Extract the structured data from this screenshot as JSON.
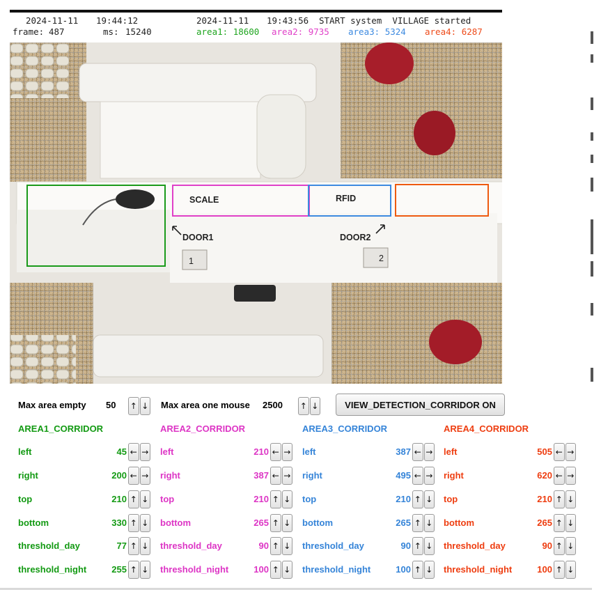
{
  "header": {
    "date": "2024-11-11",
    "time": "19:44:12",
    "frame_label": "frame:",
    "frame_value": "487",
    "ms_label": "ms:",
    "ms_value": "15240",
    "event_date": "2024-11-11",
    "event_time": "19:43:56",
    "event_text": "START system  VILLAGE started",
    "areas": [
      {
        "label": "area1:",
        "value": "18600",
        "color": "#1fa51f"
      },
      {
        "label": "area2:",
        "value": "9735",
        "color": "#e040c8"
      },
      {
        "label": "area3:",
        "value": "5324",
        "color": "#3d8ae0"
      },
      {
        "label": "area4:",
        "value": "6287",
        "color": "#ee4b1a"
      }
    ]
  },
  "camera": {
    "labels": {
      "scale": "SCALE",
      "rfid": "RFID",
      "door1": "DOOR1",
      "door2": "DOOR2",
      "marker1": "1",
      "marker2": "2"
    },
    "rect_colors": [
      "#1a9a1a",
      "#e040c8",
      "#3d8ae0",
      "#ee5a10"
    ]
  },
  "controls": {
    "max_area_empty_label": "Max area empty",
    "max_area_empty_value": "50",
    "max_area_one_mouse_label": "Max area one mouse",
    "max_area_one_mouse_value": "2500",
    "view_button_label": "VIEW_DETECTION_CORRIDOR ON",
    "arrows_ud": {
      "up": "↑",
      "down": "↓"
    },
    "arrows_lr": {
      "left": "←",
      "right": "→"
    }
  },
  "corridors": [
    {
      "title": "AREA1_CORRIDOR",
      "color": "#139a13",
      "params": [
        {
          "name": "left",
          "value": "45"
        },
        {
          "name": "right",
          "value": "200"
        },
        {
          "name": "top",
          "value": "210"
        },
        {
          "name": "bottom",
          "value": "330"
        },
        {
          "name": "threshold_day",
          "value": "77"
        },
        {
          "name": "threshold_night",
          "value": "255"
        }
      ]
    },
    {
      "title": "AREA2_CORRIDOR",
      "color": "#dd35c5",
      "params": [
        {
          "name": "left",
          "value": "210"
        },
        {
          "name": "right",
          "value": "387"
        },
        {
          "name": "top",
          "value": "210"
        },
        {
          "name": "bottom",
          "value": "265"
        },
        {
          "name": "threshold_day",
          "value": "90"
        },
        {
          "name": "threshold_night",
          "value": "100"
        }
      ]
    },
    {
      "title": "AREA3_CORRIDOR",
      "color": "#3584d8",
      "params": [
        {
          "name": "left",
          "value": "387"
        },
        {
          "name": "right",
          "value": "495"
        },
        {
          "name": "top",
          "value": "210"
        },
        {
          "name": "bottom",
          "value": "265"
        },
        {
          "name": "threshold_day",
          "value": "90"
        },
        {
          "name": "threshold_night",
          "value": "100"
        }
      ]
    },
    {
      "title": "AREA4_CORRIDOR",
      "color": "#ee3d10",
      "params": [
        {
          "name": "left",
          "value": "505"
        },
        {
          "name": "right",
          "value": "620"
        },
        {
          "name": "top",
          "value": "210"
        },
        {
          "name": "bottom",
          "value": "265"
        },
        {
          "name": "threshold_day",
          "value": "90"
        },
        {
          "name": "threshold_night",
          "value": "100"
        }
      ]
    }
  ]
}
